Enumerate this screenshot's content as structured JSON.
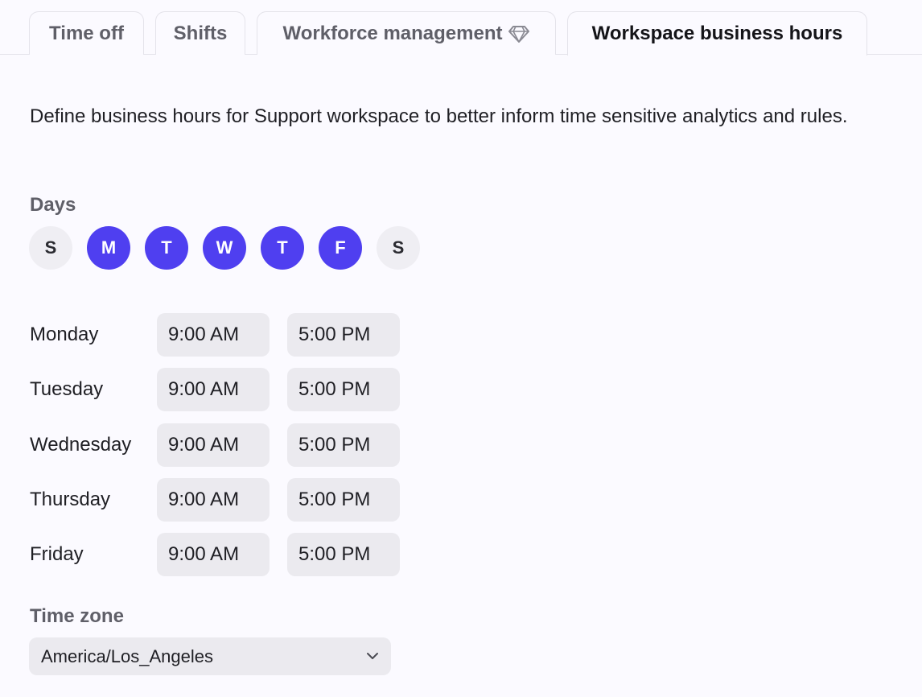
{
  "tabs": [
    {
      "label": "Time off",
      "active": false
    },
    {
      "label": "Shifts",
      "active": false
    },
    {
      "label": "Workforce management",
      "active": false,
      "icon": "diamond-icon"
    },
    {
      "label": "Workspace business hours",
      "active": true
    }
  ],
  "description": "Define business hours for Support workspace to better inform time sensitive analytics and rules.",
  "days_section": {
    "label": "Days",
    "days": [
      {
        "letter": "S",
        "selected": false
      },
      {
        "letter": "M",
        "selected": true
      },
      {
        "letter": "T",
        "selected": true
      },
      {
        "letter": "W",
        "selected": true
      },
      {
        "letter": "T",
        "selected": true
      },
      {
        "letter": "F",
        "selected": true
      },
      {
        "letter": "S",
        "selected": false
      }
    ]
  },
  "hours": [
    {
      "day": "Monday",
      "start": "9:00 AM",
      "end": "5:00 PM"
    },
    {
      "day": "Tuesday",
      "start": "9:00 AM",
      "end": "5:00 PM"
    },
    {
      "day": "Wednesday",
      "start": "9:00 AM",
      "end": "5:00 PM"
    },
    {
      "day": "Thursday",
      "start": "9:00 AM",
      "end": "5:00 PM"
    },
    {
      "day": "Friday",
      "start": "9:00 AM",
      "end": "5:00 PM"
    }
  ],
  "timezone": {
    "label": "Time zone",
    "value": "America/Los_Angeles"
  },
  "colors": {
    "accent": "#4f3ff0",
    "background": "#fbfaff",
    "field": "#ebeaef"
  }
}
